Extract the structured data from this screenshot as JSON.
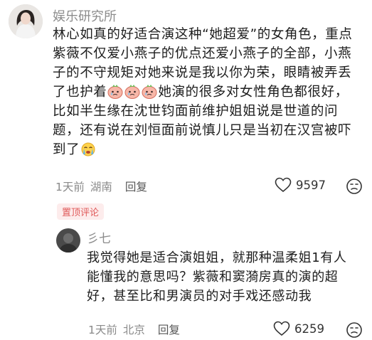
{
  "comment": {
    "username": "娱乐研究所",
    "lines": [
      "林心如真的好适合演这种“她超爱”的女角色，重点",
      "紫薇不仅爱小燕子的优点还爱小燕子的全部，小燕",
      "子的不守规矩对她来说是我以你为荣，眼睛被弄丢",
      "了也护着",
      "她演的很多对女性角色都很好，",
      "比如半生缘在沈世钧面前维护姐姐说是世道的问",
      "题，还有说在刘恒面前说慎儿只是当初在汉宫被吓",
      "到了"
    ],
    "time": "1天前",
    "location": "湖南",
    "reply_label": "回复",
    "likes": "9597",
    "pin_label": "置顶评论"
  },
  "reply": {
    "username": "彡七",
    "lines": [
      "我觉得她是适合演姐姐，就那种温柔姐1有人",
      "能懂我的意思吗？紫薇和窦漪房真的演的超",
      "好，甚至比和男演员的对手戏还感动我"
    ],
    "time": "1天前",
    "location": "北京",
    "reply_label": "回复",
    "likes": "6259"
  }
}
